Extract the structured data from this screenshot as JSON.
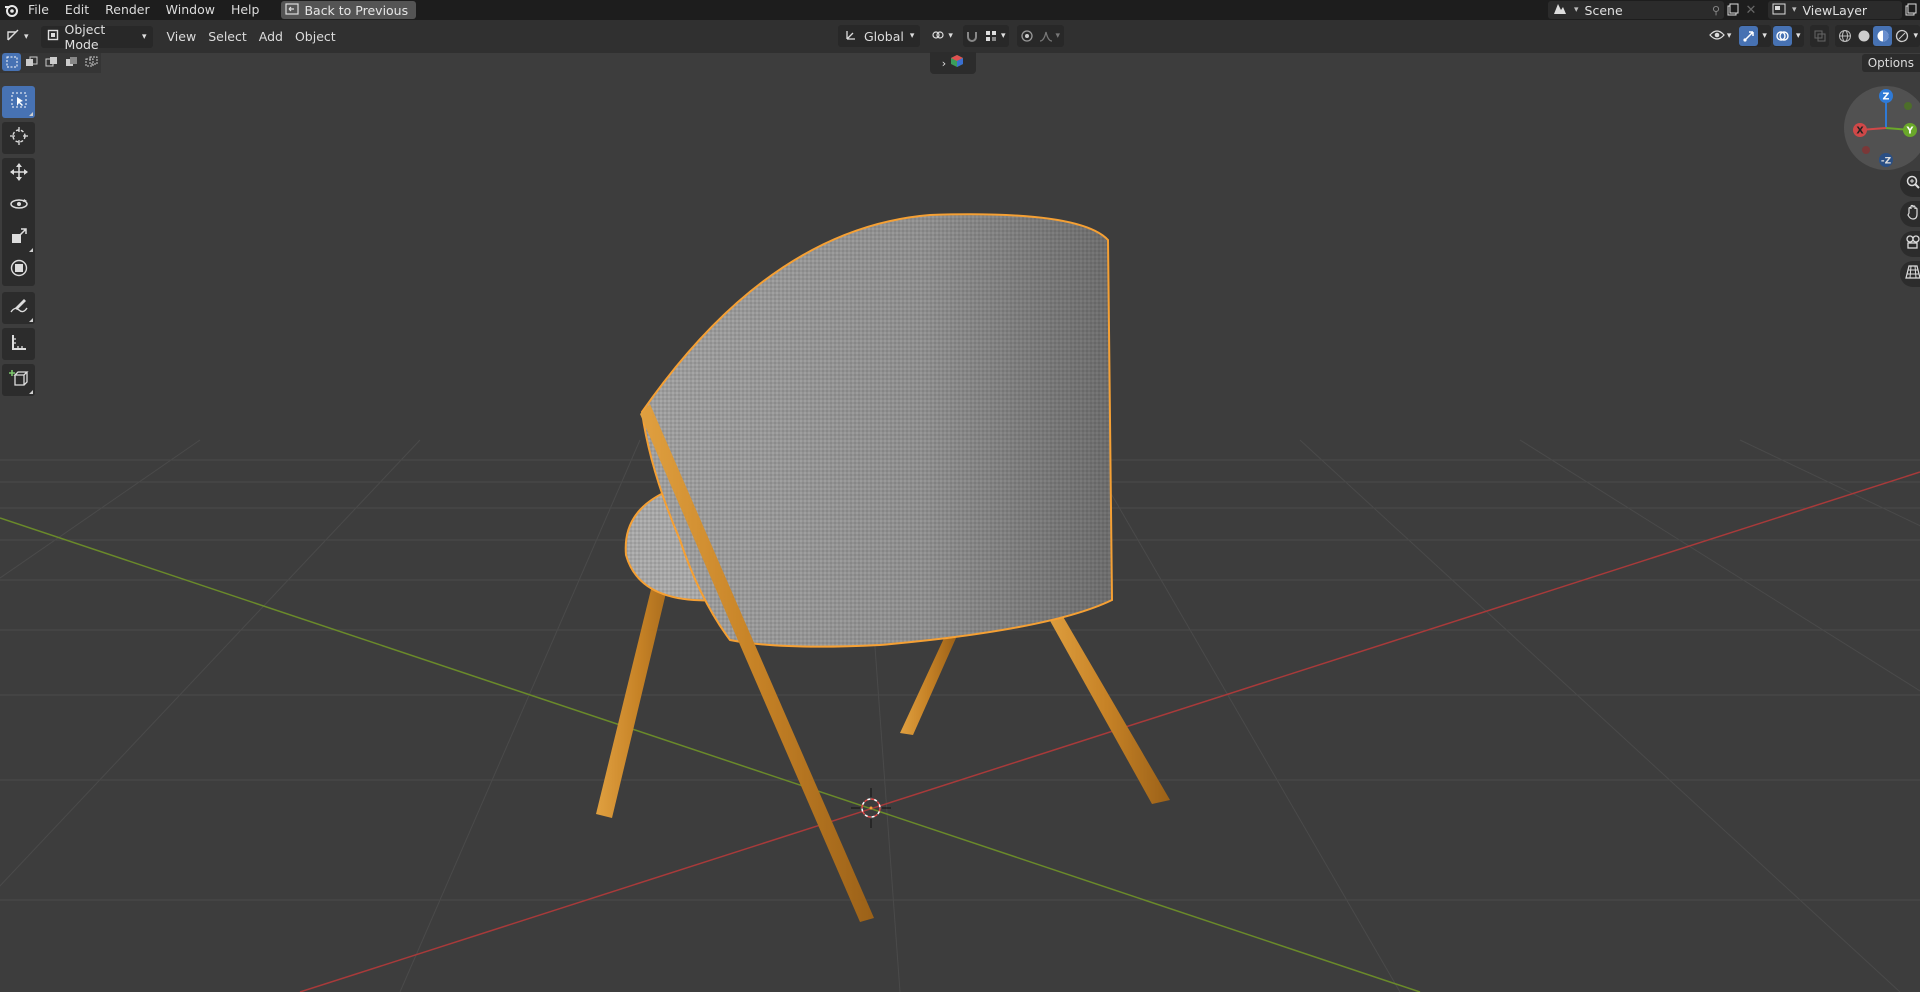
{
  "topbar": {
    "menus": [
      "File",
      "Edit",
      "Render",
      "Window",
      "Help"
    ],
    "back_button": "Back to Previous",
    "scene_name": "Scene",
    "view_layer": "ViewLayer"
  },
  "header": {
    "mode": "Object Mode",
    "menus": [
      "View",
      "Select",
      "Add",
      "Object"
    ],
    "transform_orientation": "Global"
  },
  "viewport": {
    "options_label": "Options",
    "gizmo_axes": {
      "x": "X",
      "y": "Y",
      "z": "Z",
      "neg_z": "-Z"
    }
  },
  "colors": {
    "accent": "#4772b3",
    "selection_outline": "#f5a034",
    "x_axis": "#a83a3a",
    "y_axis": "#6a8a2a",
    "wood": "#c8862e",
    "fabric": "#a9a9a9"
  },
  "tools": [
    "select-box",
    "cursor",
    "move",
    "rotate",
    "scale",
    "transform",
    "annotate",
    "measure",
    "add-cube"
  ]
}
